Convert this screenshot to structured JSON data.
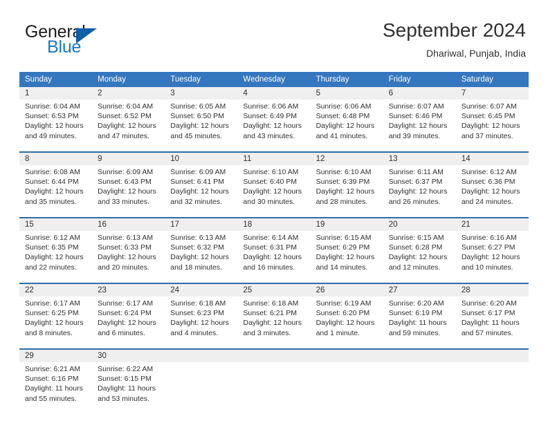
{
  "brand": {
    "general": "General",
    "blue": "Blue",
    "icon": "triangle-logo"
  },
  "header": {
    "title": "September 2024",
    "subtitle": "Dhariwal, Punjab, India"
  },
  "colors": {
    "header_blue": "#3577bf",
    "rule_blue": "#2e6da4",
    "daynum_band": "#efefef",
    "text": "#303030",
    "brand_blue": "#1878c4"
  },
  "weekdays": [
    "Sunday",
    "Monday",
    "Tuesday",
    "Wednesday",
    "Thursday",
    "Friday",
    "Saturday"
  ],
  "weeks": [
    [
      {
        "day": "1",
        "sunrise": "Sunrise: 6:04 AM",
        "sunset": "Sunset: 6:53 PM",
        "daylight1": "Daylight: 12 hours",
        "daylight2": "and 49 minutes."
      },
      {
        "day": "2",
        "sunrise": "Sunrise: 6:04 AM",
        "sunset": "Sunset: 6:52 PM",
        "daylight1": "Daylight: 12 hours",
        "daylight2": "and 47 minutes."
      },
      {
        "day": "3",
        "sunrise": "Sunrise: 6:05 AM",
        "sunset": "Sunset: 6:50 PM",
        "daylight1": "Daylight: 12 hours",
        "daylight2": "and 45 minutes."
      },
      {
        "day": "4",
        "sunrise": "Sunrise: 6:06 AM",
        "sunset": "Sunset: 6:49 PM",
        "daylight1": "Daylight: 12 hours",
        "daylight2": "and 43 minutes."
      },
      {
        "day": "5",
        "sunrise": "Sunrise: 6:06 AM",
        "sunset": "Sunset: 6:48 PM",
        "daylight1": "Daylight: 12 hours",
        "daylight2": "and 41 minutes."
      },
      {
        "day": "6",
        "sunrise": "Sunrise: 6:07 AM",
        "sunset": "Sunset: 6:46 PM",
        "daylight1": "Daylight: 12 hours",
        "daylight2": "and 39 minutes."
      },
      {
        "day": "7",
        "sunrise": "Sunrise: 6:07 AM",
        "sunset": "Sunset: 6:45 PM",
        "daylight1": "Daylight: 12 hours",
        "daylight2": "and 37 minutes."
      }
    ],
    [
      {
        "day": "8",
        "sunrise": "Sunrise: 6:08 AM",
        "sunset": "Sunset: 6:44 PM",
        "daylight1": "Daylight: 12 hours",
        "daylight2": "and 35 minutes."
      },
      {
        "day": "9",
        "sunrise": "Sunrise: 6:09 AM",
        "sunset": "Sunset: 6:43 PM",
        "daylight1": "Daylight: 12 hours",
        "daylight2": "and 33 minutes."
      },
      {
        "day": "10",
        "sunrise": "Sunrise: 6:09 AM",
        "sunset": "Sunset: 6:41 PM",
        "daylight1": "Daylight: 12 hours",
        "daylight2": "and 32 minutes."
      },
      {
        "day": "11",
        "sunrise": "Sunrise: 6:10 AM",
        "sunset": "Sunset: 6:40 PM",
        "daylight1": "Daylight: 12 hours",
        "daylight2": "and 30 minutes."
      },
      {
        "day": "12",
        "sunrise": "Sunrise: 6:10 AM",
        "sunset": "Sunset: 6:39 PM",
        "daylight1": "Daylight: 12 hours",
        "daylight2": "and 28 minutes."
      },
      {
        "day": "13",
        "sunrise": "Sunrise: 6:11 AM",
        "sunset": "Sunset: 6:37 PM",
        "daylight1": "Daylight: 12 hours",
        "daylight2": "and 26 minutes."
      },
      {
        "day": "14",
        "sunrise": "Sunrise: 6:12 AM",
        "sunset": "Sunset: 6:36 PM",
        "daylight1": "Daylight: 12 hours",
        "daylight2": "and 24 minutes."
      }
    ],
    [
      {
        "day": "15",
        "sunrise": "Sunrise: 6:12 AM",
        "sunset": "Sunset: 6:35 PM",
        "daylight1": "Daylight: 12 hours",
        "daylight2": "and 22 minutes."
      },
      {
        "day": "16",
        "sunrise": "Sunrise: 6:13 AM",
        "sunset": "Sunset: 6:33 PM",
        "daylight1": "Daylight: 12 hours",
        "daylight2": "and 20 minutes."
      },
      {
        "day": "17",
        "sunrise": "Sunrise: 6:13 AM",
        "sunset": "Sunset: 6:32 PM",
        "daylight1": "Daylight: 12 hours",
        "daylight2": "and 18 minutes."
      },
      {
        "day": "18",
        "sunrise": "Sunrise: 6:14 AM",
        "sunset": "Sunset: 6:31 PM",
        "daylight1": "Daylight: 12 hours",
        "daylight2": "and 16 minutes."
      },
      {
        "day": "19",
        "sunrise": "Sunrise: 6:15 AM",
        "sunset": "Sunset: 6:29 PM",
        "daylight1": "Daylight: 12 hours",
        "daylight2": "and 14 minutes."
      },
      {
        "day": "20",
        "sunrise": "Sunrise: 6:15 AM",
        "sunset": "Sunset: 6:28 PM",
        "daylight1": "Daylight: 12 hours",
        "daylight2": "and 12 minutes."
      },
      {
        "day": "21",
        "sunrise": "Sunrise: 6:16 AM",
        "sunset": "Sunset: 6:27 PM",
        "daylight1": "Daylight: 12 hours",
        "daylight2": "and 10 minutes."
      }
    ],
    [
      {
        "day": "22",
        "sunrise": "Sunrise: 6:17 AM",
        "sunset": "Sunset: 6:25 PM",
        "daylight1": "Daylight: 12 hours",
        "daylight2": "and 8 minutes."
      },
      {
        "day": "23",
        "sunrise": "Sunrise: 6:17 AM",
        "sunset": "Sunset: 6:24 PM",
        "daylight1": "Daylight: 12 hours",
        "daylight2": "and 6 minutes."
      },
      {
        "day": "24",
        "sunrise": "Sunrise: 6:18 AM",
        "sunset": "Sunset: 6:23 PM",
        "daylight1": "Daylight: 12 hours",
        "daylight2": "and 4 minutes."
      },
      {
        "day": "25",
        "sunrise": "Sunrise: 6:18 AM",
        "sunset": "Sunset: 6:21 PM",
        "daylight1": "Daylight: 12 hours",
        "daylight2": "and 3 minutes."
      },
      {
        "day": "26",
        "sunrise": "Sunrise: 6:19 AM",
        "sunset": "Sunset: 6:20 PM",
        "daylight1": "Daylight: 12 hours",
        "daylight2": "and 1 minute."
      },
      {
        "day": "27",
        "sunrise": "Sunrise: 6:20 AM",
        "sunset": "Sunset: 6:19 PM",
        "daylight1": "Daylight: 11 hours",
        "daylight2": "and 59 minutes."
      },
      {
        "day": "28",
        "sunrise": "Sunrise: 6:20 AM",
        "sunset": "Sunset: 6:17 PM",
        "daylight1": "Daylight: 11 hours",
        "daylight2": "and 57 minutes."
      }
    ],
    [
      {
        "day": "29",
        "sunrise": "Sunrise: 6:21 AM",
        "sunset": "Sunset: 6:16 PM",
        "daylight1": "Daylight: 11 hours",
        "daylight2": "and 55 minutes."
      },
      {
        "day": "30",
        "sunrise": "Sunrise: 6:22 AM",
        "sunset": "Sunset: 6:15 PM",
        "daylight1": "Daylight: 11 hours",
        "daylight2": "and 53 minutes."
      },
      {
        "day": "",
        "sunrise": "",
        "sunset": "",
        "daylight1": "",
        "daylight2": ""
      },
      {
        "day": "",
        "sunrise": "",
        "sunset": "",
        "daylight1": "",
        "daylight2": ""
      },
      {
        "day": "",
        "sunrise": "",
        "sunset": "",
        "daylight1": "",
        "daylight2": ""
      },
      {
        "day": "",
        "sunrise": "",
        "sunset": "",
        "daylight1": "",
        "daylight2": ""
      },
      {
        "day": "",
        "sunrise": "",
        "sunset": "",
        "daylight1": "",
        "daylight2": ""
      }
    ]
  ]
}
